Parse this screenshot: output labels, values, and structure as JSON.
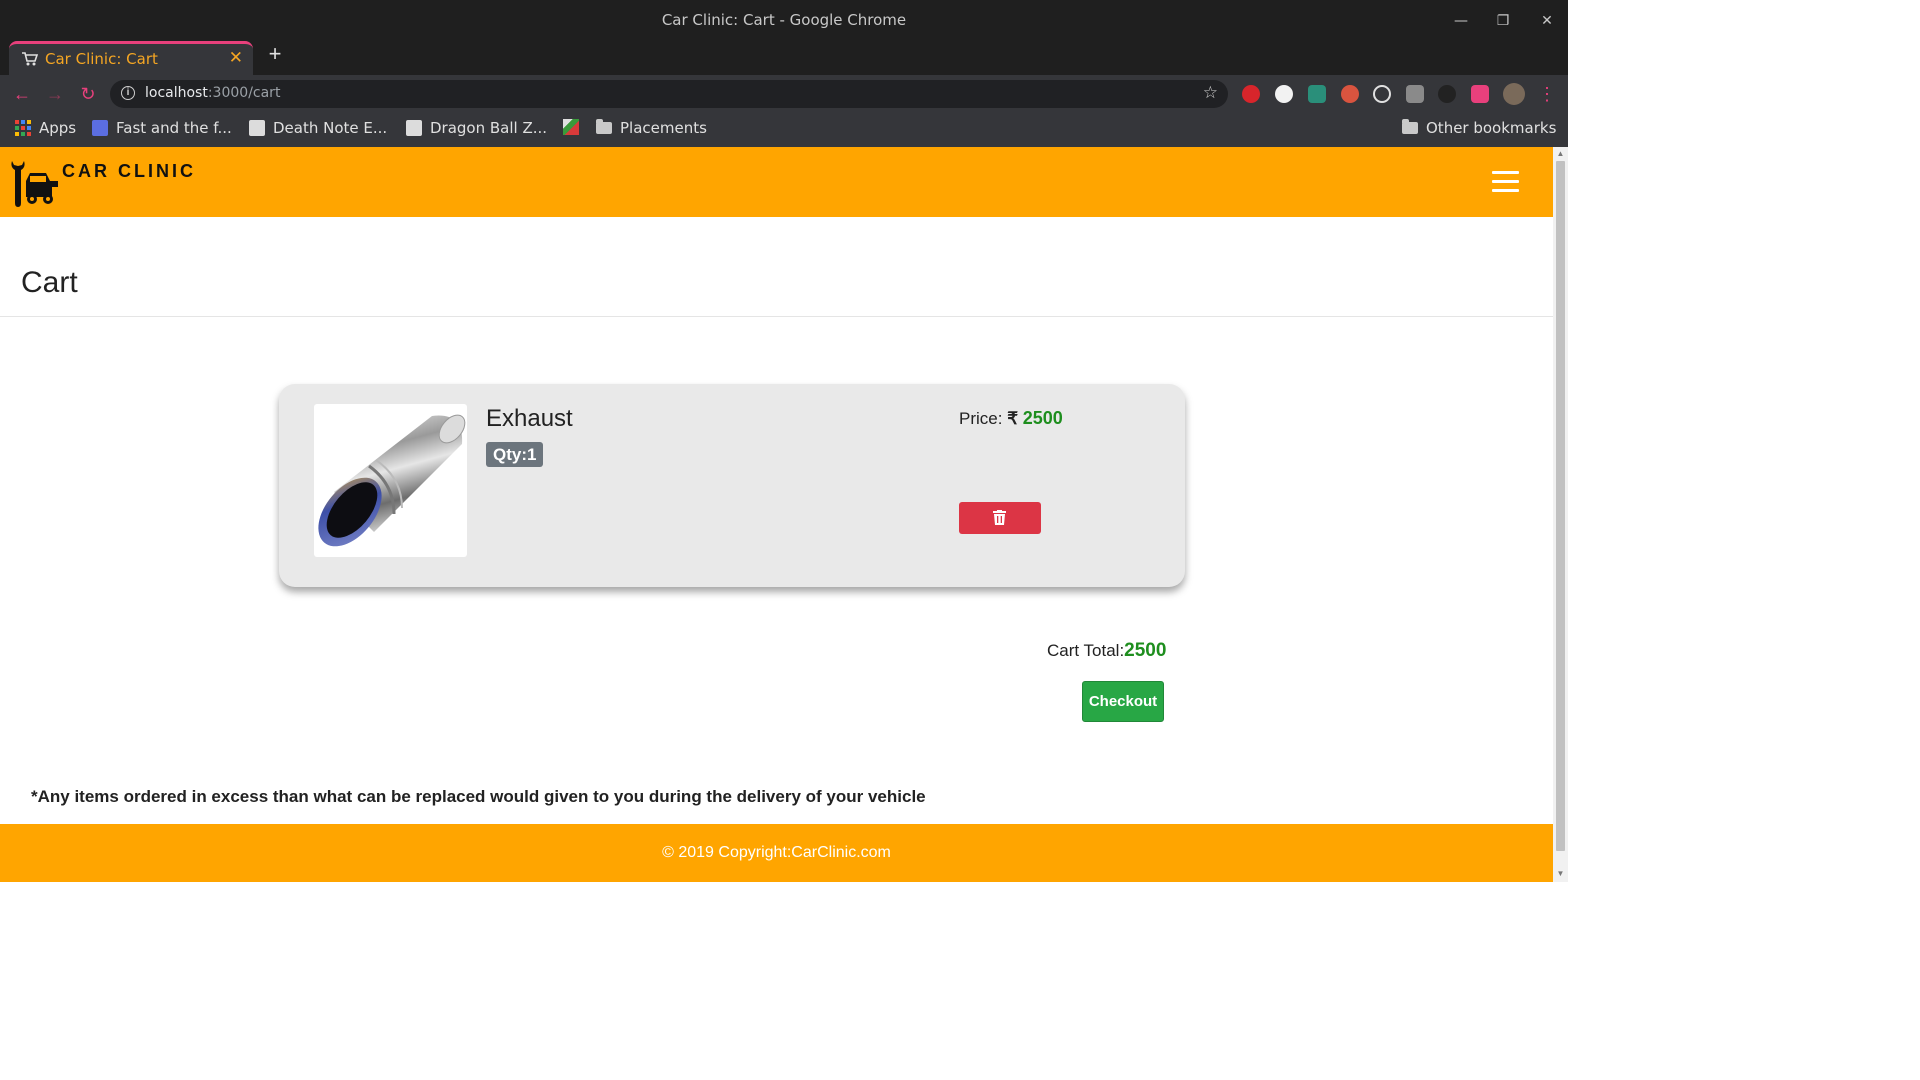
{
  "window": {
    "title": "Car Clinic: Cart - Google Chrome"
  },
  "tab": {
    "title": "Car Clinic: Cart",
    "close": "✕",
    "new_tab": "+"
  },
  "address_bar": {
    "host": "localhost",
    "path": ":3000/cart"
  },
  "bookmarks": {
    "items": [
      {
        "label": "Apps",
        "icon": "apps-grid-icon"
      },
      {
        "label": "Fast and the f...",
        "icon": "bookmark-favicon"
      },
      {
        "label": "Death Note E...",
        "icon": "bookmark-favicon"
      },
      {
        "label": "Dragon Ball Z...",
        "icon": "bookmark-favicon"
      },
      {
        "label": "Placements",
        "icon": "folder-icon"
      }
    ],
    "other": "Other bookmarks"
  },
  "site": {
    "brand": "CAR CLINIC",
    "accent_color": "#ffa500"
  },
  "cart": {
    "heading": "Cart",
    "items": [
      {
        "name": "Exhaust",
        "qty_label": "Qty:1",
        "price_label": "Price:",
        "currency": "₹",
        "price": "2500"
      }
    ],
    "total_label": "Cart Total:",
    "total": "2500",
    "checkout_label": "Checkout"
  },
  "note": "*Any items ordered in excess than what can be replaced would given to you during the delivery of your vehicle",
  "footer": {
    "copyright": "© 2019 Copyright:CarClinic.com"
  }
}
